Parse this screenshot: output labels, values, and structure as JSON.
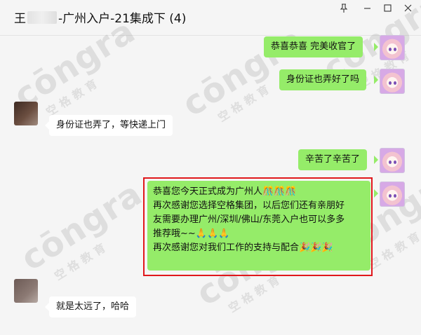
{
  "window": {
    "title_prefix": "王",
    "title_suffix": "-广州入户-21集成下 (4)",
    "controls": {
      "pin_icon": "pin-icon",
      "minimize_icon": "minimize-icon",
      "maximize_icon": "maximize-icon",
      "close_icon": "close-icon"
    }
  },
  "messages": [
    {
      "side": "right",
      "text": "恭喜恭喜  完美收官了"
    },
    {
      "side": "right",
      "text": "身份证也弄好了吗"
    },
    {
      "side": "left",
      "text": "身份证也弄了，等快递上门"
    },
    {
      "side": "right",
      "text": "辛苦了辛苦了"
    },
    {
      "side": "right",
      "highlighted": true,
      "lines": [
        "恭喜您今天正式成为广州人",
        "再次感谢您选择空格集团，以后您们还有亲朋好",
        "友需要办理广州/深圳/佛山/东莞入户也可以多多",
        "推荐哦~~",
        "再次感谢您对我们工作的支持与配合"
      ],
      "line1_emojis": "🎊🎊🎊",
      "line4_emojis": "🙏🙏🙏",
      "line5_emojis": "🎉🎉🎉"
    },
    {
      "side": "left",
      "text": "就是太远了，哈哈"
    }
  ],
  "watermark": {
    "brand": "cōngra",
    "subtitle": "空格教育"
  },
  "colors": {
    "bubble_right": "#95ec69",
    "bubble_left": "#ffffff",
    "highlight_border": "#e0181c",
    "background": "#f5f5f5"
  }
}
